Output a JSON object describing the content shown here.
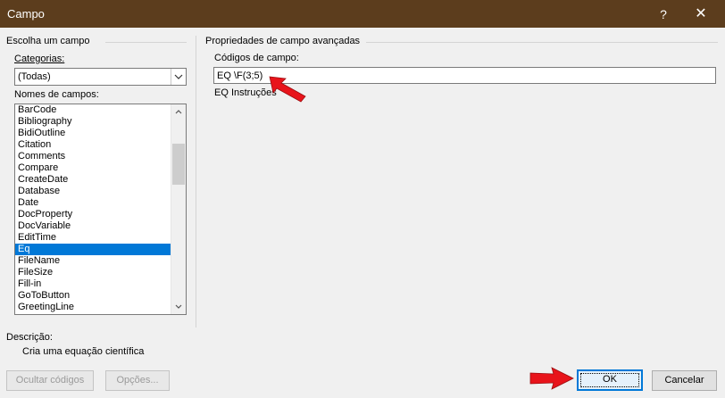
{
  "window": {
    "title": "Campo",
    "help_label": "?",
    "close_label": "✕"
  },
  "left_group": {
    "title": "Escolha um campo",
    "categories_label": "Categorias:",
    "categories_value": "(Todas)",
    "field_names_label": "Nomes de campos:",
    "field_names": [
      "BarCode",
      "Bibliography",
      "BidiOutline",
      "Citation",
      "Comments",
      "Compare",
      "CreateDate",
      "Database",
      "Date",
      "DocProperty",
      "DocVariable",
      "EditTime",
      "Eq",
      "FileName",
      "FileSize",
      "Fill-in",
      "GoToButton",
      "GreetingLine"
    ],
    "selected_field": "Eq"
  },
  "right_group": {
    "title": "Propriedades de campo avançadas",
    "field_codes_label": "Códigos de campo:",
    "field_codes_value": "EQ \\F(3;5)",
    "instructions_label": "EQ Instruções"
  },
  "description": {
    "label": "Descrição:",
    "text": "Cria uma equação científica"
  },
  "buttons": {
    "hide_codes": "Ocultar códigos",
    "options": "Opções...",
    "ok": "OK",
    "cancel": "Cancelar"
  },
  "colors": {
    "titlebar": "#5c3d1d",
    "selection": "#0078d7",
    "annotation_arrow": "#e8141b"
  },
  "icons": {
    "combo_arrow": "chevron-down-icon",
    "scroll_up": "scroll-up-icon",
    "scroll_down": "scroll-down-icon",
    "annotation": "red-arrow-icon"
  }
}
